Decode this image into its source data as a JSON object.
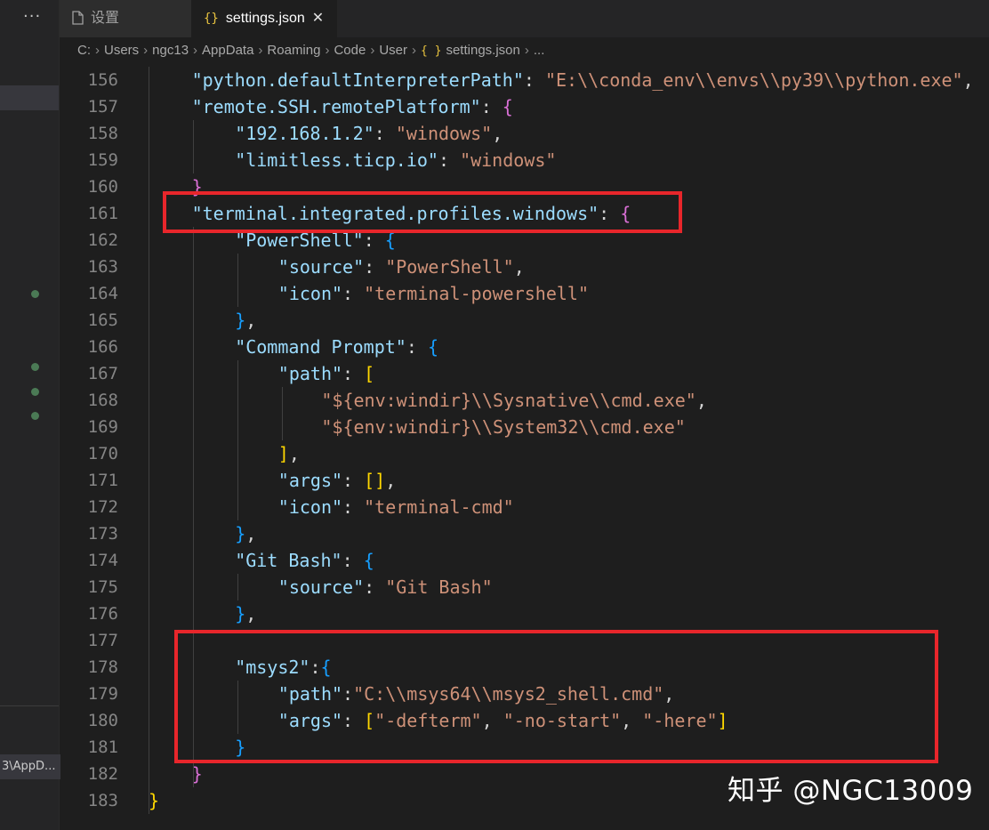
{
  "sidebar": {
    "more_label": "···",
    "path_label": "3\\AppD..."
  },
  "tabs": [
    {
      "label": "设置",
      "icon": "file-icon"
    },
    {
      "label": "settings.json",
      "icon": "json-braces-icon",
      "close": "✕"
    }
  ],
  "breadcrumb": {
    "items": [
      "C:",
      "Users",
      "ngc13",
      "AppData",
      "Roaming",
      "Code",
      "User"
    ],
    "file_icon": "{ }",
    "file": "settings.json",
    "ellipsis": "..."
  },
  "editor": {
    "line_numbers": [
      "156",
      "157",
      "158",
      "159",
      "160",
      "161",
      "162",
      "163",
      "164",
      "165",
      "166",
      "167",
      "168",
      "169",
      "170",
      "171",
      "172",
      "173",
      "174",
      "175",
      "176",
      "177",
      "178",
      "179",
      "180",
      "181",
      "182",
      "183"
    ],
    "lines": [
      [
        {
          "t": "\"python.defaultInterpreterPath\"",
          "c": "k"
        },
        {
          "t": ": ",
          "c": "p"
        },
        {
          "t": "\"E:\\\\conda_env\\\\envs\\\\py39\\\\python.exe\"",
          "c": "s"
        },
        {
          "t": ",",
          "c": "p"
        }
      ],
      [
        {
          "t": "\"remote.SSH.remotePlatform\"",
          "c": "k"
        },
        {
          "t": ": ",
          "c": "p"
        },
        {
          "t": "{",
          "c": "b2"
        }
      ],
      [
        {
          "t": "\"192.168.1.2\"",
          "c": "k"
        },
        {
          "t": ": ",
          "c": "p"
        },
        {
          "t": "\"windows\"",
          "c": "s"
        },
        {
          "t": ",",
          "c": "p"
        }
      ],
      [
        {
          "t": "\"limitless.ticp.io\"",
          "c": "k"
        },
        {
          "t": ": ",
          "c": "p"
        },
        {
          "t": "\"windows\"",
          "c": "s"
        }
      ],
      [
        {
          "t": "}",
          "c": "b2"
        }
      ],
      [
        {
          "t": "\"terminal.integrated.profiles.windows\"",
          "c": "k"
        },
        {
          "t": ": ",
          "c": "p"
        },
        {
          "t": "{",
          "c": "b2"
        }
      ],
      [
        {
          "t": "\"PowerShell\"",
          "c": "k"
        },
        {
          "t": ": ",
          "c": "p"
        },
        {
          "t": "{",
          "c": "b3"
        }
      ],
      [
        {
          "t": "\"source\"",
          "c": "k"
        },
        {
          "t": ": ",
          "c": "p"
        },
        {
          "t": "\"PowerShell\"",
          "c": "s"
        },
        {
          "t": ",",
          "c": "p"
        }
      ],
      [
        {
          "t": "\"icon\"",
          "c": "k"
        },
        {
          "t": ": ",
          "c": "p"
        },
        {
          "t": "\"terminal-powershell\"",
          "c": "s"
        }
      ],
      [
        {
          "t": "}",
          "c": "b3"
        },
        {
          "t": ",",
          "c": "p"
        }
      ],
      [
        {
          "t": "\"Command Prompt\"",
          "c": "k"
        },
        {
          "t": ": ",
          "c": "p"
        },
        {
          "t": "{",
          "c": "b3"
        }
      ],
      [
        {
          "t": "\"path\"",
          "c": "k"
        },
        {
          "t": ": ",
          "c": "p"
        },
        {
          "t": "[",
          "c": "b1"
        }
      ],
      [
        {
          "t": "\"${env:windir}\\\\Sysnative\\\\cmd.exe\"",
          "c": "s"
        },
        {
          "t": ",",
          "c": "p"
        }
      ],
      [
        {
          "t": "\"${env:windir}\\\\System32\\\\cmd.exe\"",
          "c": "s"
        }
      ],
      [
        {
          "t": "]",
          "c": "b1"
        },
        {
          "t": ",",
          "c": "p"
        }
      ],
      [
        {
          "t": "\"args\"",
          "c": "k"
        },
        {
          "t": ": ",
          "c": "p"
        },
        {
          "t": "[]",
          "c": "b1"
        },
        {
          "t": ",",
          "c": "p"
        }
      ],
      [
        {
          "t": "\"icon\"",
          "c": "k"
        },
        {
          "t": ": ",
          "c": "p"
        },
        {
          "t": "\"terminal-cmd\"",
          "c": "s"
        }
      ],
      [
        {
          "t": "}",
          "c": "b3"
        },
        {
          "t": ",",
          "c": "p"
        }
      ],
      [
        {
          "t": "\"Git Bash\"",
          "c": "k"
        },
        {
          "t": ": ",
          "c": "p"
        },
        {
          "t": "{",
          "c": "b3"
        }
      ],
      [
        {
          "t": "\"source\"",
          "c": "k"
        },
        {
          "t": ": ",
          "c": "p"
        },
        {
          "t": "\"Git Bash\"",
          "c": "s"
        }
      ],
      [
        {
          "t": "}",
          "c": "b3"
        },
        {
          "t": ",",
          "c": "p"
        }
      ],
      [],
      [
        {
          "t": "\"msys2\"",
          "c": "k"
        },
        {
          "t": ":",
          "c": "p"
        },
        {
          "t": "{",
          "c": "b3"
        }
      ],
      [
        {
          "t": "\"path\"",
          "c": "k"
        },
        {
          "t": ":",
          "c": "p"
        },
        {
          "t": "\"C:\\\\msys64\\\\msys2_shell.cmd\"",
          "c": "s"
        },
        {
          "t": ",",
          "c": "p"
        }
      ],
      [
        {
          "t": "\"args\"",
          "c": "k"
        },
        {
          "t": ": ",
          "c": "p"
        },
        {
          "t": "[",
          "c": "b1"
        },
        {
          "t": "\"-defterm\"",
          "c": "s"
        },
        {
          "t": ", ",
          "c": "p"
        },
        {
          "t": "\"-no-start\"",
          "c": "s"
        },
        {
          "t": ", ",
          "c": "p"
        },
        {
          "t": "\"-here\"",
          "c": "s"
        },
        {
          "t": "]",
          "c": "b1"
        }
      ],
      [
        {
          "t": "}",
          "c": "b3"
        }
      ],
      [
        {
          "t": "}",
          "c": "b2"
        }
      ],
      [
        {
          "t": "}",
          "c": "b1"
        }
      ]
    ]
  },
  "watermark": "知乎 @NGC13009",
  "colors": {
    "background": "#1e1e1e",
    "key": "#9cdcfe",
    "string": "#ce9178",
    "bracket_gold": "#ffd700",
    "bracket_orchid": "#da70d6",
    "bracket_blue": "#179fff",
    "highlight_box": "#e8262b"
  }
}
